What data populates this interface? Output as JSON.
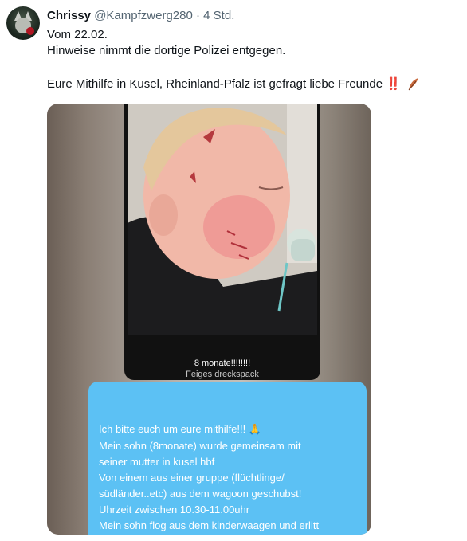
{
  "post": {
    "author_name": "Chrissy",
    "handle": "@Kampfzwerg280",
    "separator": "·",
    "time": "4 Std.",
    "line1": "Vom 22.02.",
    "line2": "Hinweise nimmt die dortige Polizei entgegen.",
    "line3": "Eure Mithilfe in Kusel, Rheinland-Pfalz ist gefragt liebe Freunde",
    "line3_emoji": "‼️",
    "feather_icon": "feather-icon"
  },
  "media": {
    "caption1": "8 monate!!!!!!!!",
    "caption2": "Feiges dreckspack",
    "message_lines": [
      "Ich bitte euch um eure mithilfe!!! 🙏",
      "Mein sohn (8monate) wurde gemeinsam mit",
      "seiner mutter in kusel hbf",
      "Von einem aus einer gruppe (flüchtlinge/",
      "südländer..etc) aus dem wagoon geschubst!",
      "Uhrzeit zwischen 10.30-11.00uhr",
      "Mein sohn flog aus dem kinderwaagen und erlitt"
    ]
  },
  "colors": {
    "bubble": "#5cc1f4",
    "secondary_text": "#536471",
    "primary_text": "#0f1419"
  }
}
